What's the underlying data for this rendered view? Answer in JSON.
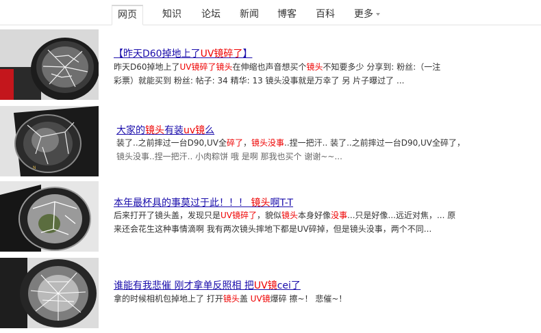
{
  "tabs": [
    "网页",
    "知识",
    "论坛",
    "新闻",
    "博客",
    "百科",
    "更多"
  ],
  "results": [
    {
      "title": [
        {
          "t": "【昨天D60掉地上了",
          "hl": false
        },
        {
          "t": "UV镜碎了",
          "hl": true
        },
        {
          "t": "】",
          "hl": false
        }
      ],
      "line1": [
        {
          "t": "昨天D60掉地上了",
          "hl": false
        },
        {
          "t": "UV镜碎了镜头",
          "hl": true
        },
        {
          "t": "在伸缩也声音想买个",
          "hl": false
        },
        {
          "t": "镜头",
          "hl": true
        },
        {
          "t": "不知要多少 分享到:  粉丝:（一注",
          "hl": false
        }
      ],
      "line2": [
        {
          "t": "彩票）就能买到 粉丝:  帖子: 34 精华: 13 镜头没事就是万幸了 另 片子曝过了 ...",
          "hl": false
        }
      ]
    },
    {
      "title": [
        {
          "t": "大家的",
          "hl": false
        },
        {
          "t": "镜头",
          "hl": true
        },
        {
          "t": "有装",
          "hl": false
        },
        {
          "t": "uv镜",
          "hl": true
        },
        {
          "t": "么",
          "hl": false
        }
      ],
      "line1": [
        {
          "t": "装了..之前摔过一台D90,UV全",
          "hl": false
        },
        {
          "t": "碎了",
          "hl": true
        },
        {
          "t": "，",
          "hl": false
        },
        {
          "t": "镜头没事",
          "hl": true
        },
        {
          "t": "..捏一把汗.. 装了..之前摔过一台D90,UV全碎了，",
          "hl": false
        }
      ],
      "line2": [
        {
          "t": "镜头没事..捏一把汗.. 小肉粽饼 哦 是啊 那我也买个 谢谢~~...",
          "hl": false
        }
      ]
    },
    {
      "title": [
        {
          "t": "本年最杯具的事莫过于此！！！ ",
          "hl": false
        },
        {
          "t": "镜头",
          "hl": true
        },
        {
          "t": "啊T-T",
          "hl": false
        }
      ],
      "line1": [
        {
          "t": "后来打开了镜头盖，发现只是",
          "hl": false
        },
        {
          "t": "UV镜碎了",
          "hl": true
        },
        {
          "t": "，貌似",
          "hl": false
        },
        {
          "t": "镜头",
          "hl": true
        },
        {
          "t": "本身好像",
          "hl": false
        },
        {
          "t": "没事",
          "hl": true
        },
        {
          "t": "...只是好像...远近对焦，... 原",
          "hl": false
        }
      ],
      "line2": [
        {
          "t": "来还会花生这种事情滴啊 我有两次镜头摔地下都是UV碎掉，但是镜头没事，两个不同...",
          "hl": false
        }
      ]
    },
    {
      "title": [
        {
          "t": "谁能有我悲催 刚才拿单反照相 把",
          "hl": false
        },
        {
          "t": "UV镜",
          "hl": true
        },
        {
          "t": "cei了",
          "hl": false
        }
      ],
      "line1": [
        {
          "t": "拿的时候相机包掉地上了 打开",
          "hl": false
        },
        {
          "t": "镜头",
          "hl": true
        },
        {
          "t": "盖 ",
          "hl": false
        },
        {
          "t": "UV镜",
          "hl": true
        },
        {
          "t": "爆碎 擦~！ 悲催~！",
          "hl": false
        }
      ],
      "line2": []
    }
  ]
}
